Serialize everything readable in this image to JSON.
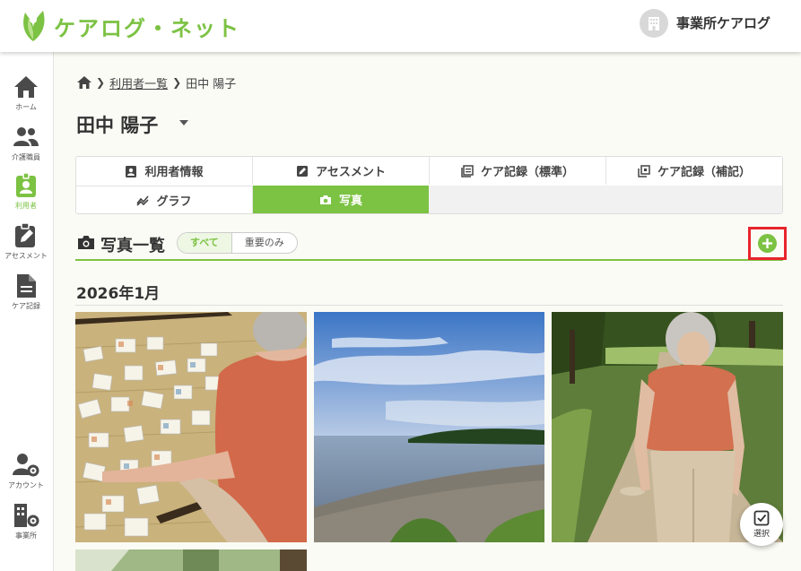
{
  "header": {
    "app_title": "ケアログ・ネット",
    "office_name": "事業所ケアログ",
    "brand_color": "#7cc243"
  },
  "sidebar": {
    "items": [
      {
        "label": "ホーム",
        "icon": "home-icon"
      },
      {
        "label": "介護職員",
        "icon": "staff-icon"
      },
      {
        "label": "利用者",
        "icon": "user-badge-icon",
        "active": true
      },
      {
        "label": "アセスメント",
        "icon": "edit-clipboard-icon"
      },
      {
        "label": "ケア記録",
        "icon": "document-icon"
      },
      {
        "label": "アカウント",
        "icon": "account-settings-icon"
      },
      {
        "label": "事業所",
        "icon": "office-settings-icon"
      }
    ]
  },
  "breadcrumb": {
    "parent": "利用者一覧",
    "current": "田中 陽子"
  },
  "page": {
    "title": "田中 陽子"
  },
  "tabs": [
    {
      "label": "利用者情報",
      "icon": "user-card-icon"
    },
    {
      "label": "アセスメント",
      "icon": "edit-icon"
    },
    {
      "label": "ケア記録（標準）",
      "icon": "records-icon"
    },
    {
      "label": "ケア記録（補記）",
      "icon": "supplement-icon"
    },
    {
      "label": "グラフ",
      "icon": "graph-icon"
    },
    {
      "label": "写真",
      "icon": "camera-icon",
      "active": true
    }
  ],
  "photos_section": {
    "title": "写真一覧",
    "filters": [
      {
        "label": "すべて",
        "active": true
      },
      {
        "label": "重要のみ",
        "active": false
      }
    ],
    "month": "2026年1月",
    "select_label": "選択"
  }
}
